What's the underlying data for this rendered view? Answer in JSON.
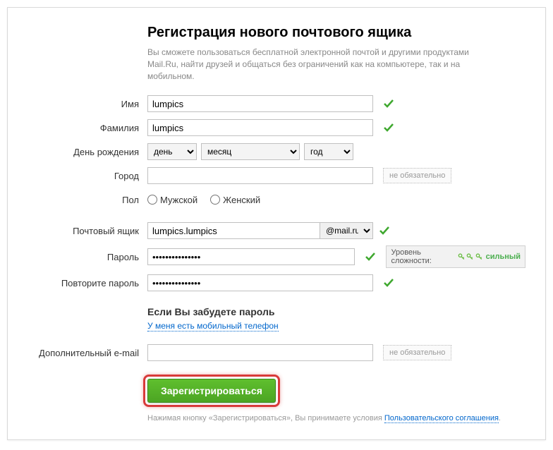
{
  "header": {
    "title": "Регистрация нового почтового ящика",
    "subtitle": "Вы сможете пользоваться бесплатной электронной почтой и другими продуктами Mail.Ru, найти друзей и общаться без ограничений как на компьютере, так и на мобильном."
  },
  "labels": {
    "firstname": "Имя",
    "lastname": "Фамилия",
    "birthday": "День рождения",
    "city": "Город",
    "gender": "Пол",
    "mailbox": "Почтовый ящик",
    "password": "Пароль",
    "password_repeat": "Повторите пароль",
    "alt_email": "Дополнительный e-mail"
  },
  "values": {
    "firstname": "lumpics",
    "lastname": "lumpics",
    "mailbox": "lumpics.lumpics",
    "domain": "@mail.ru",
    "password": "•••••••••••••••",
    "password_repeat": "•••••••••••••••"
  },
  "birthday": {
    "day": "день",
    "month": "месяц",
    "year": "год"
  },
  "gender": {
    "male": "Мужской",
    "female": "Женский"
  },
  "hints": {
    "optional": "не обязательно",
    "strength_label": "Уровень сложности:",
    "strength_value": "сильный"
  },
  "forgot": {
    "title": "Если Вы забудете пароль",
    "phone_link": "У меня есть мобильный телефон"
  },
  "submit": {
    "label": "Зарегистрироваться"
  },
  "footer": {
    "prefix": "Нажимая кнопку «Зарегистрироваться», Вы принимаете условия ",
    "link": "Пользовательского соглашения",
    "suffix": "."
  }
}
